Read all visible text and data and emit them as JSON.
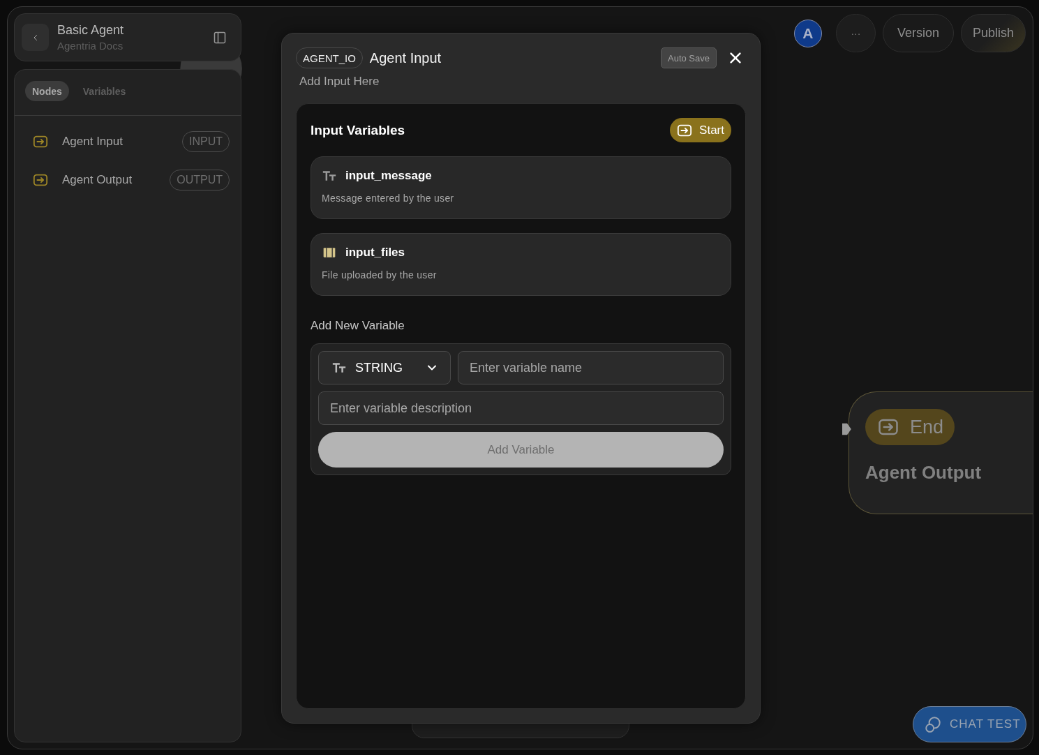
{
  "sidebar": {
    "title": "Basic Agent",
    "subtitle": "Agentria Docs",
    "tabs": [
      {
        "label": "Nodes",
        "selected": true
      },
      {
        "label": "Variables",
        "selected": false
      }
    ],
    "nodes": [
      {
        "label": "Agent Input",
        "tag": "INPUT"
      },
      {
        "label": "Agent Output",
        "tag": "OUTPUT"
      }
    ]
  },
  "topbar": {
    "avatar": "A",
    "more": "···",
    "buttons": [
      "Version",
      "Publish"
    ]
  },
  "modal": {
    "tag": "AGENT_IO",
    "title": "Agent Input",
    "subtitle": "Add Input Here",
    "auto_save": "Auto Save",
    "section_title": "Input Variables",
    "badge": "Start",
    "variables": [
      {
        "kind": "string",
        "name": "input_message",
        "description": "Message entered by the user"
      },
      {
        "kind": "file",
        "name": "input_files",
        "description": "File uploaded by the user"
      }
    ],
    "add_title": "Add New Variable",
    "type_select": {
      "kind": "string",
      "value": "STRING"
    },
    "name_field": {
      "placeholder": "Enter variable name"
    },
    "description_field": {
      "placeholder": "Enter variable description"
    },
    "add_button": {
      "label": "Add Variable",
      "disabled": true
    }
  },
  "canvas_node": {
    "badge": "End",
    "title": "Agent Output"
  },
  "chat_button": "CHAT TEST"
}
